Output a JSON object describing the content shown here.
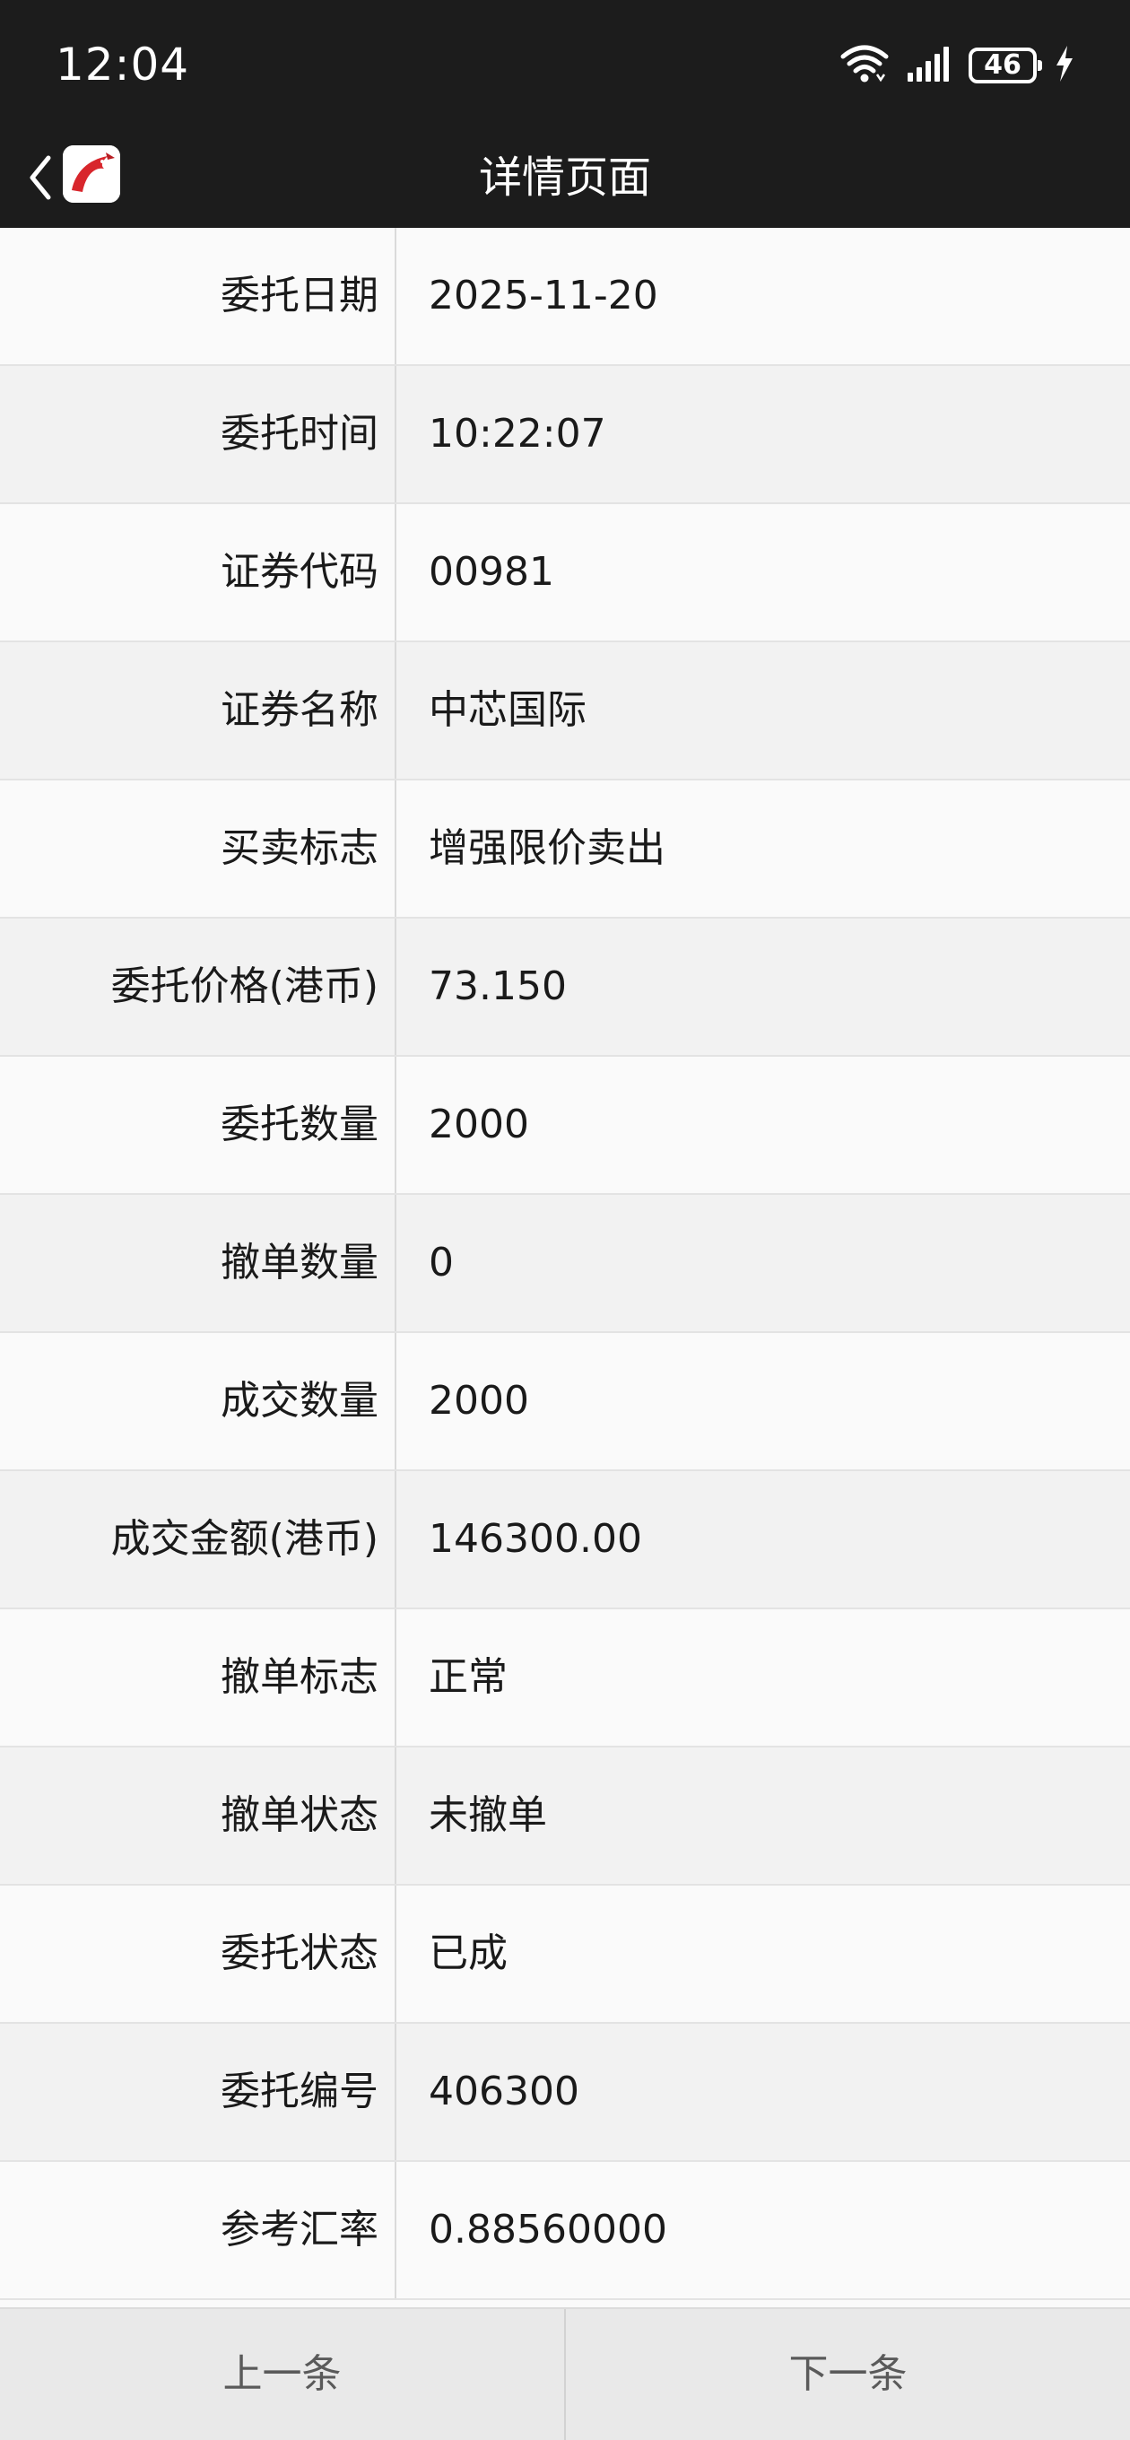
{
  "status_bar": {
    "time": "12:04",
    "battery": "46",
    "icons": [
      "wifi-icon",
      "signal-icon",
      "battery-icon",
      "charging-icon"
    ]
  },
  "nav": {
    "title": "详情页面",
    "back_icon": "chevron-left-icon",
    "logo_icon": "app-logo-icon"
  },
  "details": [
    {
      "label": "委托日期",
      "value": "2025-11-20"
    },
    {
      "label": "委托时间",
      "value": "10:22:07"
    },
    {
      "label": "证券代码",
      "value": "00981"
    },
    {
      "label": "证券名称",
      "value": "中芯国际"
    },
    {
      "label": "买卖标志",
      "value": "增强限价卖出"
    },
    {
      "label": "委托价格(港币)",
      "value": "73.150"
    },
    {
      "label": "委托数量",
      "value": "2000"
    },
    {
      "label": "撤单数量",
      "value": "0"
    },
    {
      "label": "成交数量",
      "value": "2000"
    },
    {
      "label": "成交金额(港币)",
      "value": "146300.00"
    },
    {
      "label": "撤单标志",
      "value": "正常"
    },
    {
      "label": "撤单状态",
      "value": "未撤单"
    },
    {
      "label": "委托状态",
      "value": "已成"
    },
    {
      "label": "委托编号",
      "value": "406300"
    },
    {
      "label": "参考汇率",
      "value": "0.88560000"
    }
  ],
  "footer": {
    "prev_label": "上一条",
    "next_label": "下一条"
  },
  "colors": {
    "header_bg": "#1c1c1c",
    "row_odd": "#fafafa",
    "row_even": "#f2f2f2",
    "logo_red": "#d8262c"
  }
}
